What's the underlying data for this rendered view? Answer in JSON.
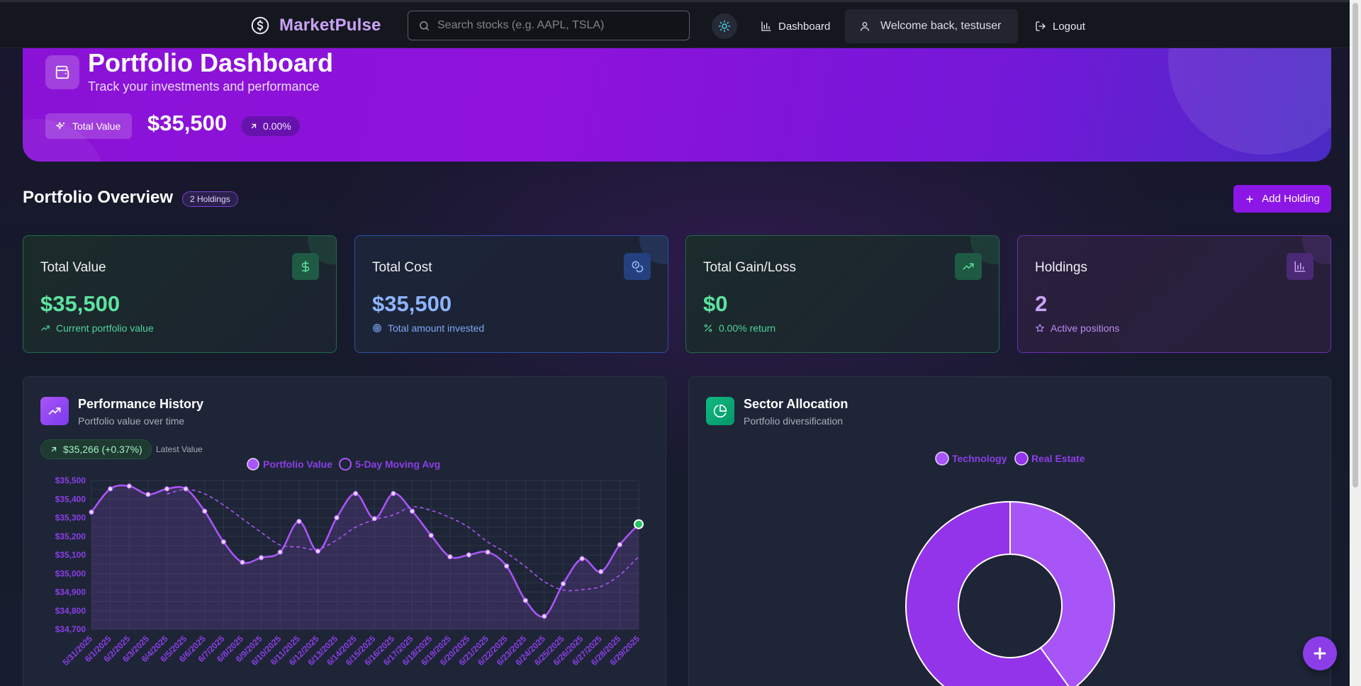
{
  "nav": {
    "brand": "MarketPulse",
    "search_placeholder": "Search stocks (e.g. AAPL, TSLA)",
    "dashboard_label": "Dashboard",
    "welcome_text": "Welcome back, testuser",
    "logout_label": "Logout"
  },
  "hero": {
    "title": "Portfolio Dashboard",
    "subtitle": "Track your investments and performance",
    "total_label": "Total Value",
    "total_value": "$35,500",
    "change": "0.00%"
  },
  "overview": {
    "title": "Portfolio Overview",
    "badge": "2 Holdings",
    "add_button": "Add Holding"
  },
  "stats": [
    {
      "title": "Total Value",
      "value": "$35,500",
      "note": "Current portfolio value",
      "icon": "dollar-icon",
      "accent": "#5ee3a1"
    },
    {
      "title": "Total Cost",
      "value": "$35,500",
      "note": "Total amount invested",
      "icon": "coins-icon",
      "accent": "#8fb4ff"
    },
    {
      "title": "Total Gain/Loss",
      "value": "$0",
      "note": "0.00% return",
      "icon": "trending-up-icon",
      "accent": "#5ee3a1"
    },
    {
      "title": "Holdings",
      "value": "2",
      "note": "Active positions",
      "icon": "bar-chart-icon",
      "accent": "#c9a3f7"
    }
  ],
  "performance": {
    "title": "Performance History",
    "subtitle": "Portfolio value over time",
    "latest_value": "$35,266 (+0.37%)",
    "latest_label": "Latest Value"
  },
  "sector": {
    "title": "Sector Allocation",
    "subtitle": "Portfolio diversification"
  },
  "chart_data": [
    {
      "type": "line",
      "legend": [
        "Portfolio Value",
        "5-Day Moving Avg"
      ],
      "legend_position": "top",
      "grid": true,
      "ylim": [
        34700,
        35500
      ],
      "y_ticks": [
        "$35,500",
        "$35,400",
        "$35,300",
        "$35,200",
        "$35,100",
        "$35,000",
        "$34,900",
        "$34,800",
        "$34,700"
      ],
      "x": [
        "5/31/2025",
        "6/1/2025",
        "6/2/2025",
        "6/3/2025",
        "6/4/2025",
        "6/5/2025",
        "6/6/2025",
        "6/7/2025",
        "6/8/2025",
        "6/9/2025",
        "6/10/2025",
        "6/11/2025",
        "6/12/2025",
        "6/13/2025",
        "6/14/2025",
        "6/15/2025",
        "6/16/2025",
        "6/17/2025",
        "6/18/2025",
        "6/19/2025",
        "6/20/2025",
        "6/21/2025",
        "6/22/2025",
        "6/23/2025",
        "6/24/2025",
        "6/25/2025",
        "6/26/2025",
        "6/27/2025",
        "6/28/2025",
        "6/29/2025"
      ],
      "series": [
        {
          "name": "Portfolio Value",
          "color": "#a855f7",
          "values": [
            35330,
            35455,
            35470,
            35425,
            35455,
            35455,
            35335,
            35170,
            35060,
            35085,
            35115,
            35280,
            35120,
            35300,
            35430,
            35295,
            35430,
            35335,
            35205,
            35090,
            35100,
            35115,
            35040,
            34855,
            34770,
            34945,
            35080,
            35010,
            35155,
            35265
          ]
        },
        {
          "name": "5-Day Moving Avg",
          "color": "#a855f7",
          "dashed": true,
          "values": [
            null,
            null,
            null,
            null,
            35427,
            35452,
            35428,
            35368,
            35294,
            35221,
            35153,
            35142,
            35130,
            35180,
            35249,
            35289,
            35315,
            35358,
            35339,
            35301,
            35248,
            35169,
            35110,
            35037,
            34956,
            34911,
            34913,
            34930,
            34992,
            35091
          ]
        }
      ]
    },
    {
      "type": "pie",
      "legend": [
        "Technology",
        "Real Estate"
      ],
      "legend_position": "top",
      "slices": [
        {
          "label": "Technology",
          "value": 40,
          "color": "#a855f7"
        },
        {
          "label": "Real Estate",
          "value": 60,
          "color": "#9333ea"
        }
      ]
    }
  ]
}
